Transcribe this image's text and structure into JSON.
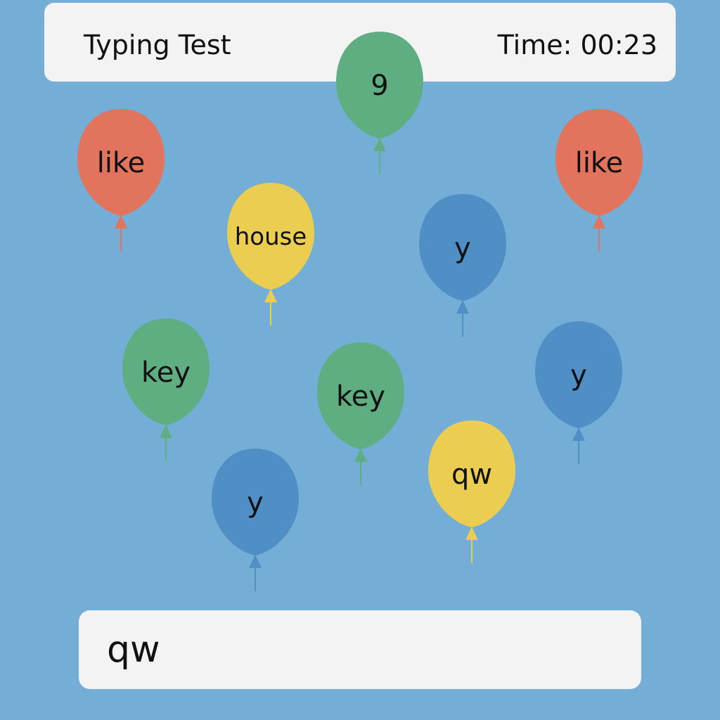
{
  "header": {
    "title": "Typing Test",
    "timer": "Time: 00:23"
  },
  "colors": {
    "background": "#74add6",
    "panel": "#f3f3f4",
    "red": "#e2735d",
    "green": "#5fae82",
    "yellow": "#ebcd52",
    "blue": "#4f8fc6"
  },
  "balloons": [
    {
      "word": "9",
      "color": "green"
    },
    {
      "word": "like",
      "color": "red"
    },
    {
      "word": "like",
      "color": "red"
    },
    {
      "word": "house",
      "color": "yellow"
    },
    {
      "word": "y",
      "color": "blue"
    },
    {
      "word": "key",
      "color": "green"
    },
    {
      "word": "key",
      "color": "green"
    },
    {
      "word": "y",
      "color": "blue"
    },
    {
      "word": "y",
      "color": "blue"
    },
    {
      "word": "qw",
      "color": "yellow"
    }
  ],
  "input": {
    "value": "qw"
  }
}
